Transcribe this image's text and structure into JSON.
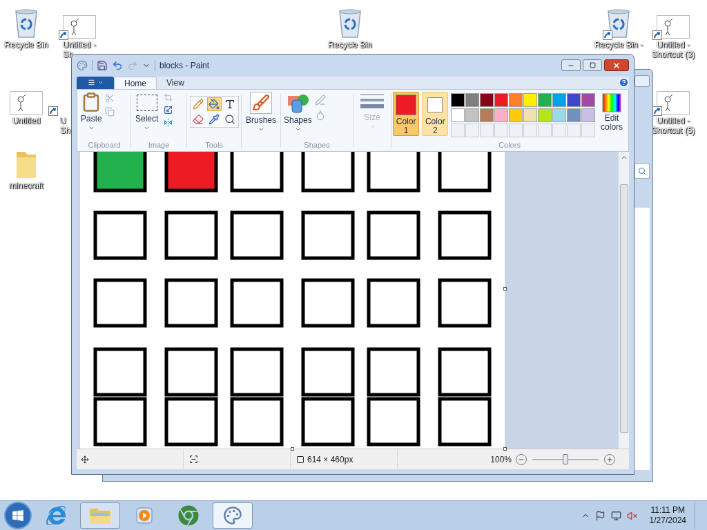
{
  "desktop": {
    "icons": [
      {
        "kind": "recycle-bin",
        "shortcut": false,
        "lines": [
          "Recycle Bin"
        ]
      },
      {
        "kind": "doodle",
        "shortcut": true,
        "lines": [
          "Untitled -",
          "Sh"
        ]
      },
      {
        "kind": "doodle",
        "shortcut": false,
        "lines": [
          "Untitled"
        ]
      },
      {
        "shortcut": true,
        "lines": [
          "U",
          "Sh"
        ]
      },
      {
        "kind": "folder",
        "shortcut": false,
        "lines": [
          "minecraft"
        ]
      },
      {
        "kind": "recycle-bin",
        "shortcut": false,
        "lines": [
          "Recycle Bin"
        ]
      },
      {
        "kind": "recycle-bin",
        "shortcut": true,
        "lines": [
          "Recycle Bin -"
        ]
      },
      {
        "kind": "doodle",
        "shortcut": true,
        "lines": [
          "Untitled -",
          "Shortcut (3)"
        ]
      },
      {
        "kind": "doodle",
        "shortcut": true,
        "lines": [
          "Untitled -",
          "Shortcut (5)"
        ]
      }
    ]
  },
  "window": {
    "title": "blocks - Paint",
    "tabs": [
      {
        "label": "Home",
        "selected": true
      },
      {
        "label": "View",
        "selected": false
      }
    ],
    "ribbon": {
      "clipboard": {
        "label": "Clipboard",
        "paste": "Paste"
      },
      "image": {
        "label": "Image",
        "select": "Select"
      },
      "tools": {
        "label": "Tools",
        "items": [
          {
            "kind": "pencil",
            "selected": false
          },
          {
            "kind": "fill",
            "selected": true
          },
          {
            "kind": "text",
            "selected": false
          },
          {
            "kind": "eraser",
            "selected": false
          },
          {
            "kind": "picker",
            "selected": false
          },
          {
            "kind": "magnifier",
            "selected": false
          }
        ]
      },
      "brushes": "Brushes",
      "shapes": {
        "label": "Shapes",
        "button": "Shapes"
      },
      "size": {
        "label": "Size",
        "disabled": true
      },
      "colors": {
        "label": "Colors",
        "slots": [
          {
            "label": "Color",
            "number": "1",
            "color": "#ed1c24",
            "selected": true
          },
          {
            "label": "Color",
            "number": "2",
            "color": "#ffffff",
            "selected": false
          }
        ],
        "palette": [
          {
            "color": "#000000"
          },
          {
            "color": "#7f7f7f"
          },
          {
            "color": "#880015"
          },
          {
            "color": "#ed1c24"
          },
          {
            "color": "#ff7f27"
          },
          {
            "color": "#fff200"
          },
          {
            "color": "#22b14c"
          },
          {
            "color": "#00a2e8"
          },
          {
            "color": "#3f48cc"
          },
          {
            "color": "#a349a4"
          },
          {
            "color": "#ffffff"
          },
          {
            "color": "#c3c3c3"
          },
          {
            "color": "#b97a57"
          },
          {
            "color": "#ffaec9"
          },
          {
            "color": "#ffc90e"
          },
          {
            "color": "#efe4b0"
          },
          {
            "color": "#b5e61d"
          },
          {
            "color": "#99d9ea"
          },
          {
            "color": "#7092be"
          },
          {
            "color": "#c8bfe7"
          }
        ],
        "edit": "Edit colors"
      }
    },
    "canvas": {
      "squares": [
        {
          "color": "#22b14c"
        },
        {
          "color": "#ed1c24"
        },
        {
          "color": "#ffffff"
        },
        {
          "color": "#ffffff"
        },
        {
          "color": "#ffffff"
        },
        {
          "color": "#ffffff"
        },
        {
          "color": "#ffffff"
        },
        {
          "color": "#ffffff"
        },
        {
          "color": "#ffffff"
        },
        {
          "color": "#ffffff"
        },
        {
          "color": "#ffffff"
        },
        {
          "color": "#ffffff"
        },
        {
          "color": "#ffffff"
        },
        {
          "color": "#ffffff"
        },
        {
          "color": "#ffffff"
        },
        {
          "color": "#ffffff"
        },
        {
          "color": "#ffffff"
        },
        {
          "color": "#ffffff"
        },
        {
          "color": "#ffffff"
        },
        {
          "color": "#ffffff"
        },
        {
          "color": "#ffffff"
        },
        {
          "color": "#ffffff"
        },
        {
          "color": "#ffffff"
        },
        {
          "color": "#ffffff"
        },
        {
          "color": "#ffffff"
        },
        {
          "color": "#ffffff"
        },
        {
          "color": "#ffffff"
        },
        {
          "color": "#ffffff"
        },
        {
          "color": "#ffffff"
        },
        {
          "color": "#ffffff"
        }
      ]
    },
    "status_bar": {
      "image_size": "614 × 460px",
      "zoom": "100%",
      "zoom_slider": {
        "level": 0.5
      }
    }
  },
  "taskbar": {
    "items": [
      {
        "kind": "ie",
        "running": false,
        "selected": false
      },
      {
        "kind": "explorer",
        "running": true,
        "selected": false
      },
      {
        "kind": "media",
        "running": false,
        "selected": false
      },
      {
        "kind": "chrome",
        "running": false,
        "selected": false
      },
      {
        "kind": "paint",
        "running": true,
        "selected": true
      }
    ],
    "time": "11:11 PM",
    "date": "1/27/2024"
  }
}
